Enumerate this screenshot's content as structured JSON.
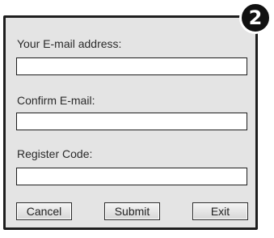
{
  "step_badge": "2",
  "form": {
    "email_label": "Your E-mail address:",
    "email_value": "",
    "confirm_label": "Confirm E-mail:",
    "confirm_value": "",
    "code_label": "Register Code:",
    "code_value": ""
  },
  "buttons": {
    "cancel": "Cancel",
    "submit": "Submit",
    "exit": "Exit"
  },
  "colors": {
    "panel_background": "#e4e4e4",
    "border": "#1e1e1e",
    "badge": "#111111"
  }
}
